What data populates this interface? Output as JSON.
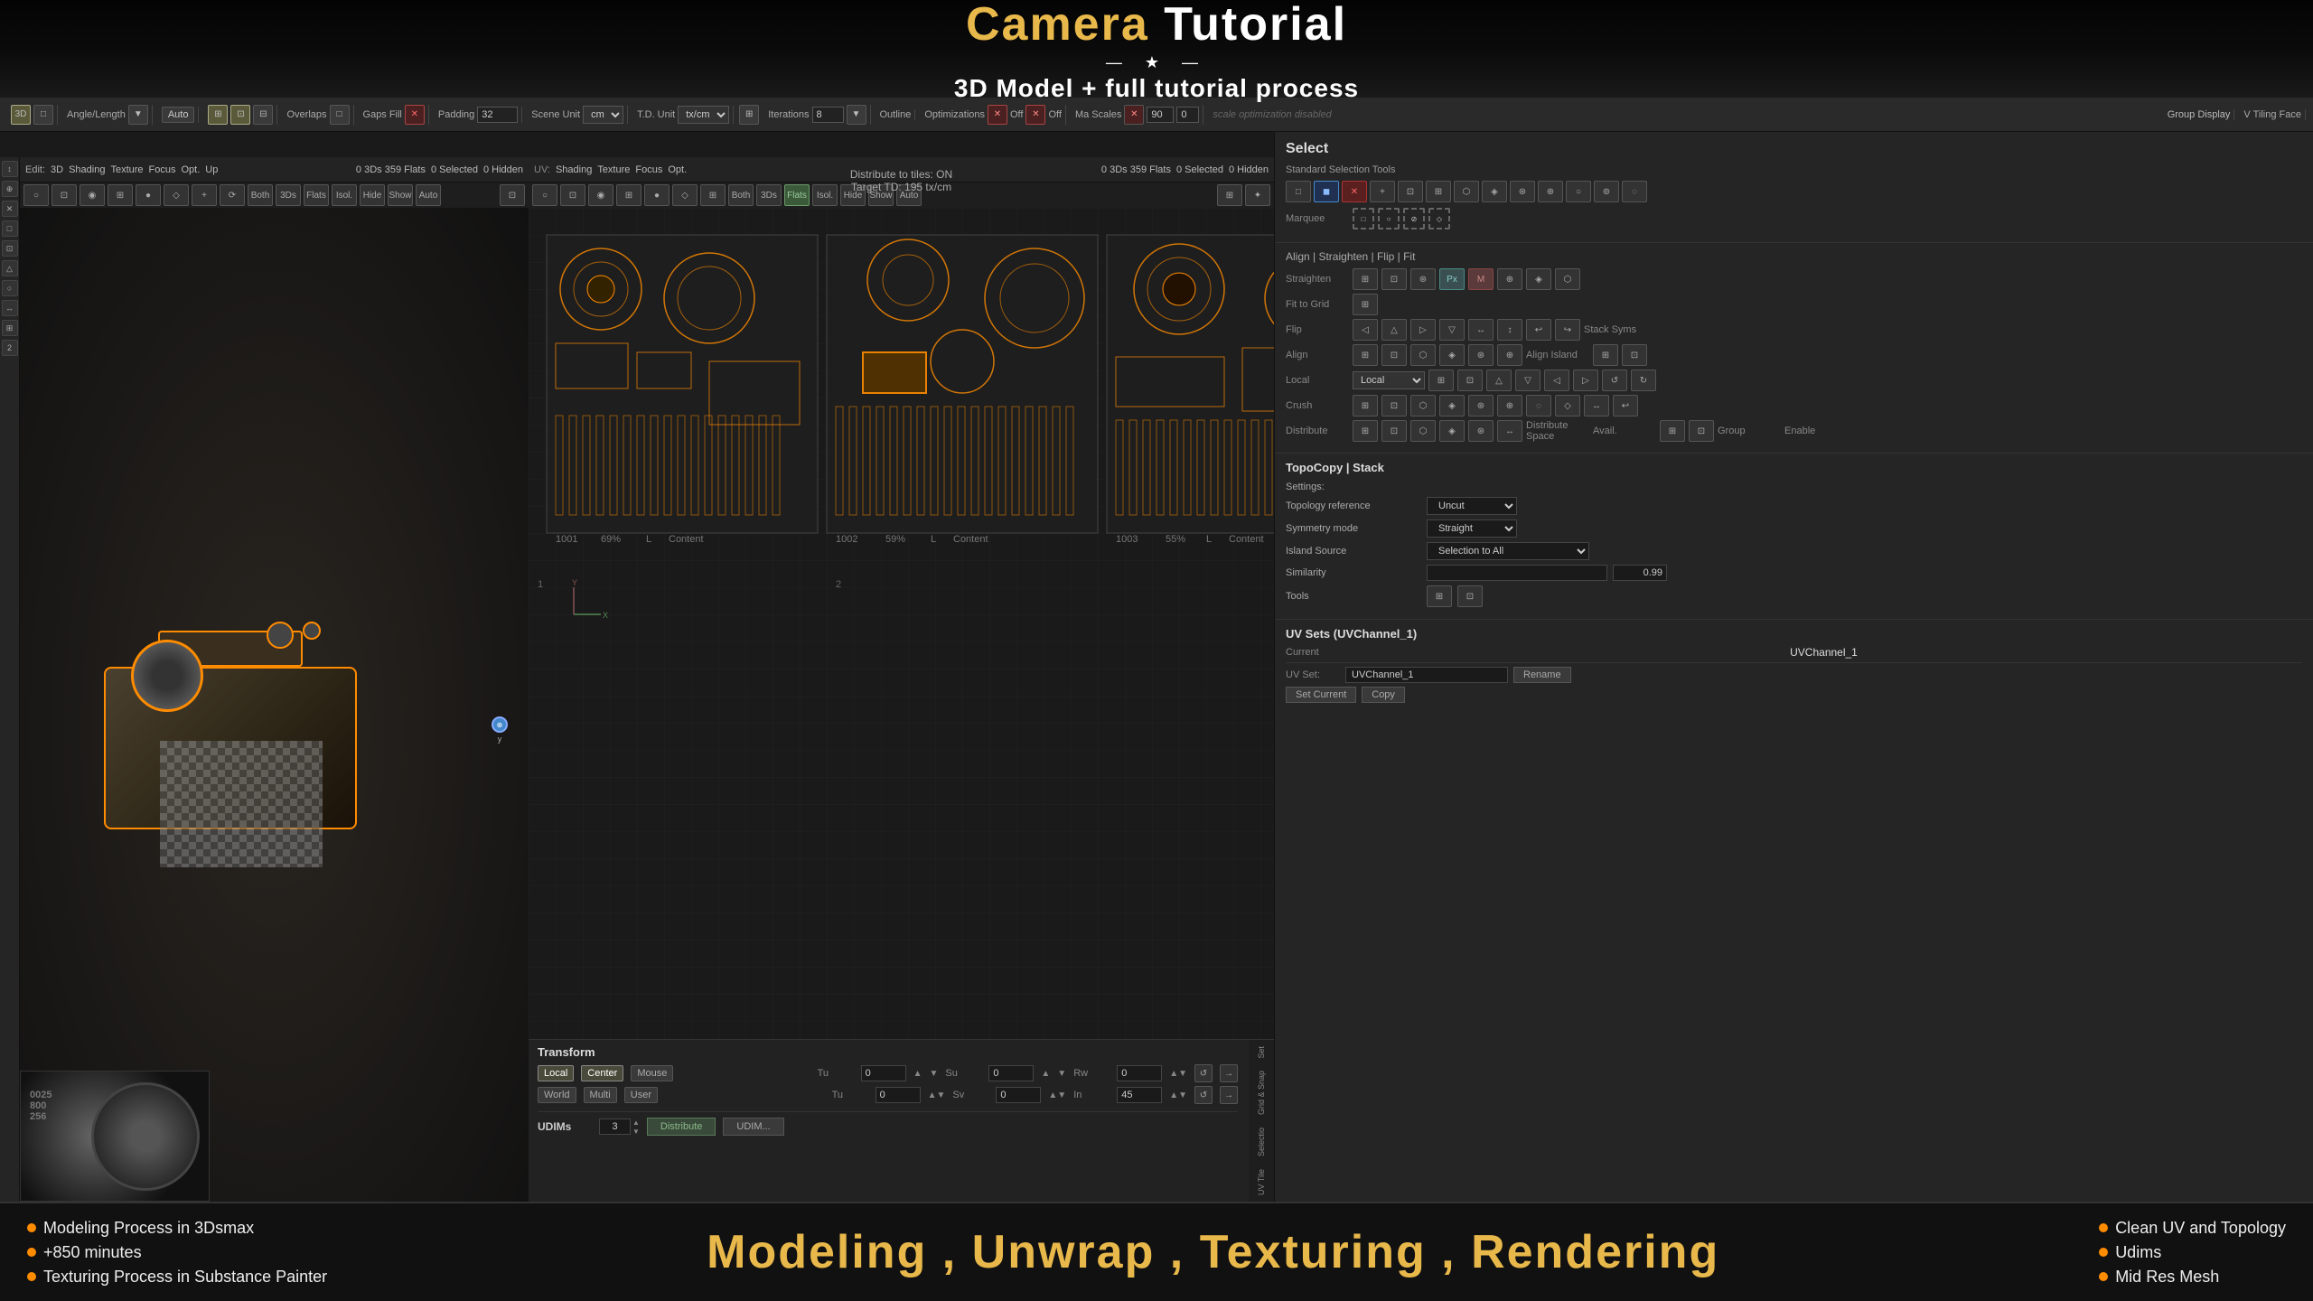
{
  "title": {
    "camera": "Camera",
    "tutorial": " Tutorial",
    "divider": "— ★ —",
    "subtitle": "3D Model + full tutorial process"
  },
  "toolbar": {
    "angle_length": "Angle/Length",
    "auto": "Auto",
    "overlaps": "Overlaps",
    "gaps": "Gaps",
    "fill_label": "Fill",
    "padding_label": "Padding",
    "padding_value": "32",
    "scene_unit_label": "Scene Unit",
    "td_unit_label": "T.D. Unit",
    "td_unit_val": "tx/cm",
    "cm_label": "cm",
    "iterations_label": "Iterations",
    "iterations_val": "8",
    "outline_label": "Outline",
    "optimizations_label": "Optimizations",
    "scale_opt_off": "Off",
    "scale_opt_val": "90",
    "scale_opt_val2": "0",
    "max_scales_label": "Ma Scales",
    "scale_opt_disabled": "scale optimization disabled",
    "group_display_label": "Group Display",
    "v_tiling_label": "V Tiling Face"
  },
  "viewport3d": {
    "stats": "0 3Ds 359 Flats",
    "selected": "0 Selected",
    "hidden": "0 Hidden",
    "mode_both": "Both",
    "mode_3ds": "3Ds",
    "mode_flats": "Flats",
    "isol": "Isol.",
    "hide": "Hide",
    "show": "Show",
    "auto": "Auto"
  },
  "uv_editor": {
    "stats": "0 3Ds 359 Flats",
    "selected": "0 Selected",
    "hidden": "0 Hidden",
    "mode_both": "Both",
    "mode_3ds": "3Ds",
    "mode_flats": "Flats",
    "isol": "Isol.",
    "hide": "Hide",
    "show": "Show",
    "auto": "Auto",
    "distribute_info": "Distribute to tiles: ON",
    "target_td": "Target TD: 195 tx/cm",
    "tile1_id": "1001",
    "tile1_pct": "69%",
    "tile1_mode": "L",
    "tile1_label": "Content",
    "tile2_id": "1002",
    "tile2_pct": "59%",
    "tile2_mode": "L",
    "tile2_label": "Content",
    "tile3_id": "1003",
    "tile3_pct": "55%",
    "tile3_mode": "L",
    "tile3_label": "Content"
  },
  "transform": {
    "header": "Transform",
    "coord_local": "Local",
    "coord_center": "Center",
    "coord_mouse": "Mouse",
    "coord_world": "World",
    "coord_multi": "Multi",
    "coord_user": "User",
    "tu_label": "Tu",
    "tu_val1": "0",
    "tu_val2": "0",
    "su_label": "Su",
    "su_val": "0",
    "rw_label": "Rw",
    "rw_val": "0",
    "sv_label": "Sv",
    "sv_val": "0",
    "in_label": "In",
    "in_val": "45"
  },
  "udims": {
    "label": "UDIMs",
    "num": "3",
    "distribute_btn": "Distribute",
    "udim_label": "UDIM..."
  },
  "right_panel": {
    "select_title": "Select",
    "standard_selection_tools": "Standard Selection Tools",
    "marquee_title": "Marquee",
    "align_title": "Align | Straighten | Flip | Fit",
    "straighten_label": "Straighten",
    "fit_to_grid_label": "Fit to Grid",
    "flip_label": "Flip",
    "stack_sym_label": "Stack Syms",
    "align_label": "Align",
    "align_island_label": "Align Island",
    "local_label": "Local",
    "crush_label": "Crush",
    "distribute_label": "Distribute",
    "distribute_space_label": "Distribute Space",
    "group_col_label": "Group",
    "enable_label": "Enable",
    "topocopy_title": "TopoCopy | Stack",
    "settings_label": "Settings:",
    "topology_ref_label": "Topology reference",
    "topology_ref_val": "Uncut",
    "symmetry_mode_label": "Symmetry mode",
    "symmetry_mode_val": "Straight",
    "island_source_label": "Island Source",
    "island_source_val": "Selection to All",
    "similarity_label": "Similarity",
    "similarity_val": "0.99",
    "tools_label": "Tools",
    "uvsets_title": "UV Sets (UVChannel_1)",
    "current_label": "Current",
    "uvchannel_name": "UVChannel_1",
    "uv_set_label": "UV Set:",
    "uvchannel_input": "UVChannel_1",
    "rename_btn": "Rename",
    "set_current_btn": "Set Current",
    "copy_btn": "Copy"
  },
  "bottom_bar": {
    "bullet1": "Modeling Process in 3Dsmax",
    "bullet2": "+850 minutes",
    "bullet3": "Texturing Process in Substance Painter",
    "main_text": "Modeling , Unwrap , Texturing , Rendering",
    "right1": "Clean UV and Topology",
    "right2": "Udims",
    "right3": "Mid Res Mesh"
  },
  "colors": {
    "accent": "#ff8c00",
    "title_gold": "#e8b84b",
    "bg_dark": "#1a1a1a",
    "panel_bg": "#252525",
    "border": "#333"
  }
}
